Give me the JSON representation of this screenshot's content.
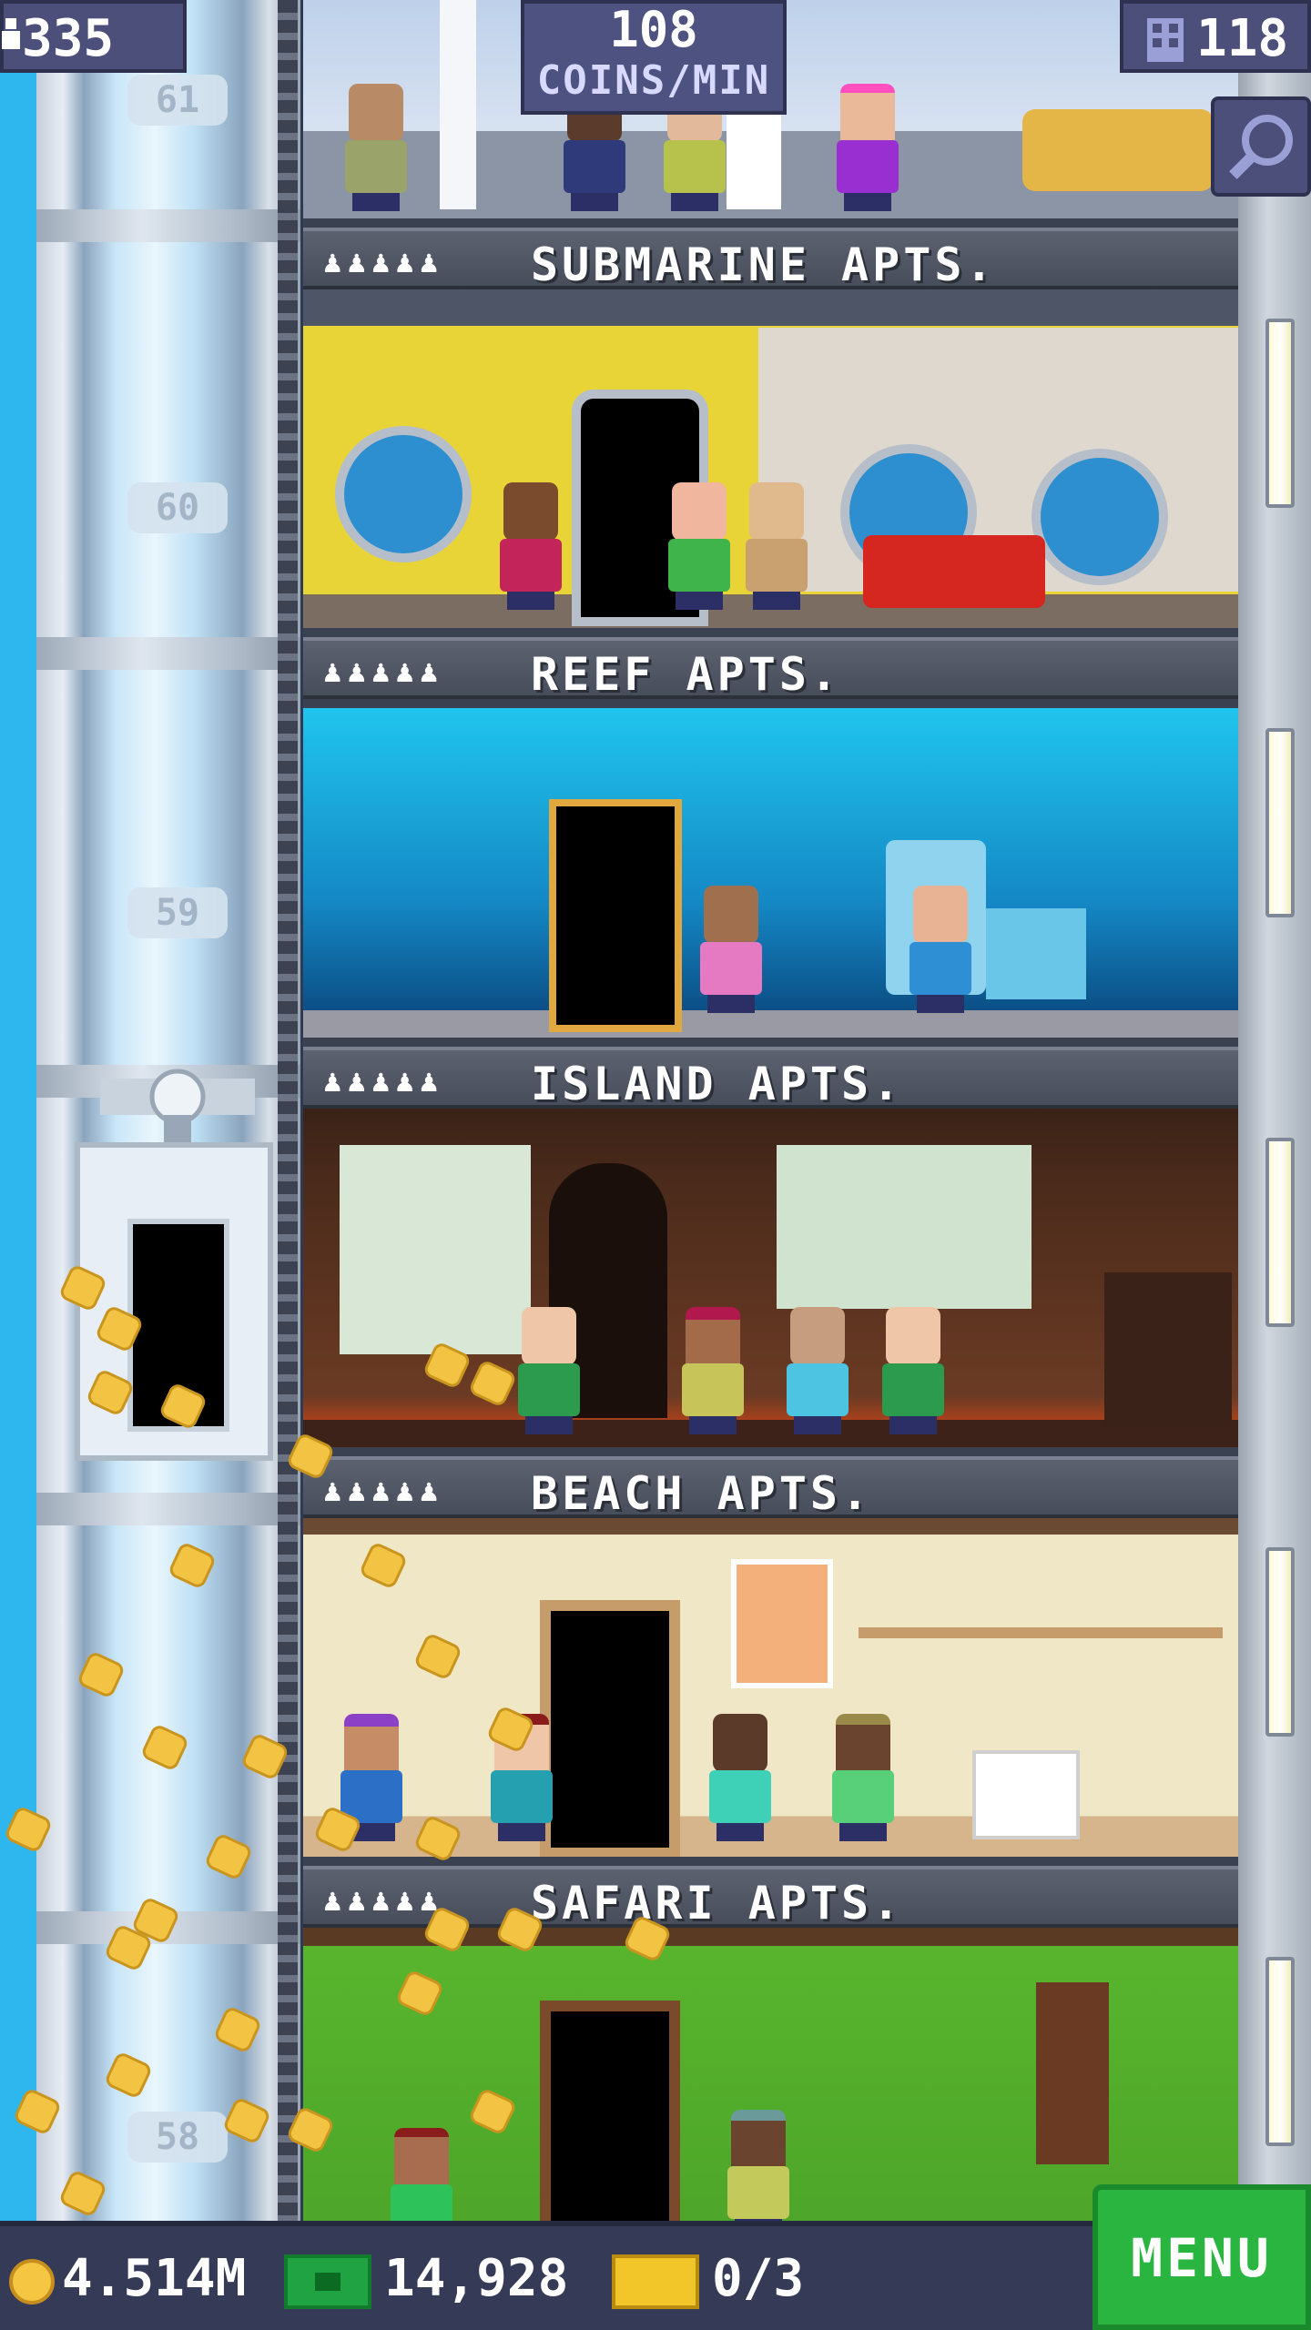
{
  "top_bar": {
    "population": "335",
    "coins_per_min_value": "108",
    "coins_per_min_unit": "COINS/MIN",
    "floors_count": "118",
    "icons": {
      "population": "person-icon",
      "floors": "building-icon",
      "search": "magnify-icon"
    }
  },
  "elevator": {
    "floor_numbers": [
      "61",
      "60",
      "59",
      "58"
    ]
  },
  "floors": [
    {
      "name": "SUBMARINE APTS.",
      "pips": "♟♟♟♟♟"
    },
    {
      "name": "REEF APTS.",
      "pips": "♟♟♟♟♟"
    },
    {
      "name": "ISLAND APTS.",
      "pips": "♟♟♟♟♟"
    },
    {
      "name": "BEACH APTS.",
      "pips": "♟♟♟♟♟"
    },
    {
      "name": "SAFARI APTS.",
      "pips": "♟♟♟♟♟"
    }
  ],
  "bottom_bar": {
    "coins": "4.514M",
    "tower_bux": "14,928",
    "tickets": "0/3",
    "menu_label": "MENU"
  },
  "colors": {
    "submarine_wall": "#e9d437",
    "reef_water": "#19b9e4",
    "island_wood": "#4a2a1b",
    "beach_wall": "#efe7c6",
    "safari_wall": "#58b52c",
    "menu_green": "#29b540"
  }
}
